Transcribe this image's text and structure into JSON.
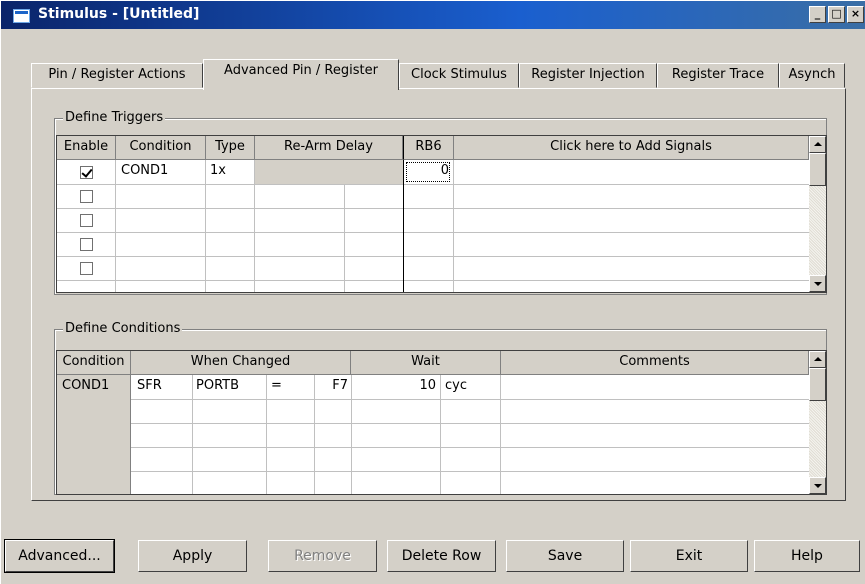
{
  "window": {
    "title": "Stimulus - [Untitled]",
    "controls": [
      "_",
      "□",
      "×"
    ]
  },
  "tabs": [
    {
      "label": "Pin / Register Actions",
      "active": false
    },
    {
      "label": "Advanced Pin / Register",
      "active": true
    },
    {
      "label": "Clock Stimulus",
      "active": false
    },
    {
      "label": "Register Injection",
      "active": false
    },
    {
      "label": "Register Trace",
      "active": false
    },
    {
      "label": "Asynch",
      "active": false
    }
  ],
  "triggers": {
    "group_label": "Define Triggers",
    "headers": {
      "enable": "Enable",
      "condition": "Condition",
      "type": "Type",
      "rearm": "Re-Arm Delay",
      "rb6": "RB6",
      "add": "Click here to Add Signals"
    },
    "rows": [
      {
        "enabled": true,
        "condition": "COND1",
        "type": "1x",
        "rb6": "0"
      },
      {
        "enabled": false,
        "condition": "",
        "type": "",
        "rb6": ""
      },
      {
        "enabled": false,
        "condition": "",
        "type": "",
        "rb6": ""
      },
      {
        "enabled": false,
        "condition": "",
        "type": "",
        "rb6": ""
      }
    ]
  },
  "conditions": {
    "group_label": "Define Conditions",
    "headers": {
      "condition": "Condition",
      "when_changed": "When Changed",
      "wait": "Wait",
      "comments": "Comments"
    },
    "rows": [
      {
        "condition": "COND1",
        "sfr": "SFR",
        "reg": "PORTB",
        "op": "=",
        "value": "F7",
        "wait": "10",
        "unit": "cyc",
        "comment": ""
      }
    ]
  },
  "buttons": {
    "advanced": "Advanced...",
    "apply": "Apply",
    "remove": "Remove",
    "delete_row": "Delete Row",
    "save": "Save",
    "exit": "Exit",
    "help": "Help"
  }
}
